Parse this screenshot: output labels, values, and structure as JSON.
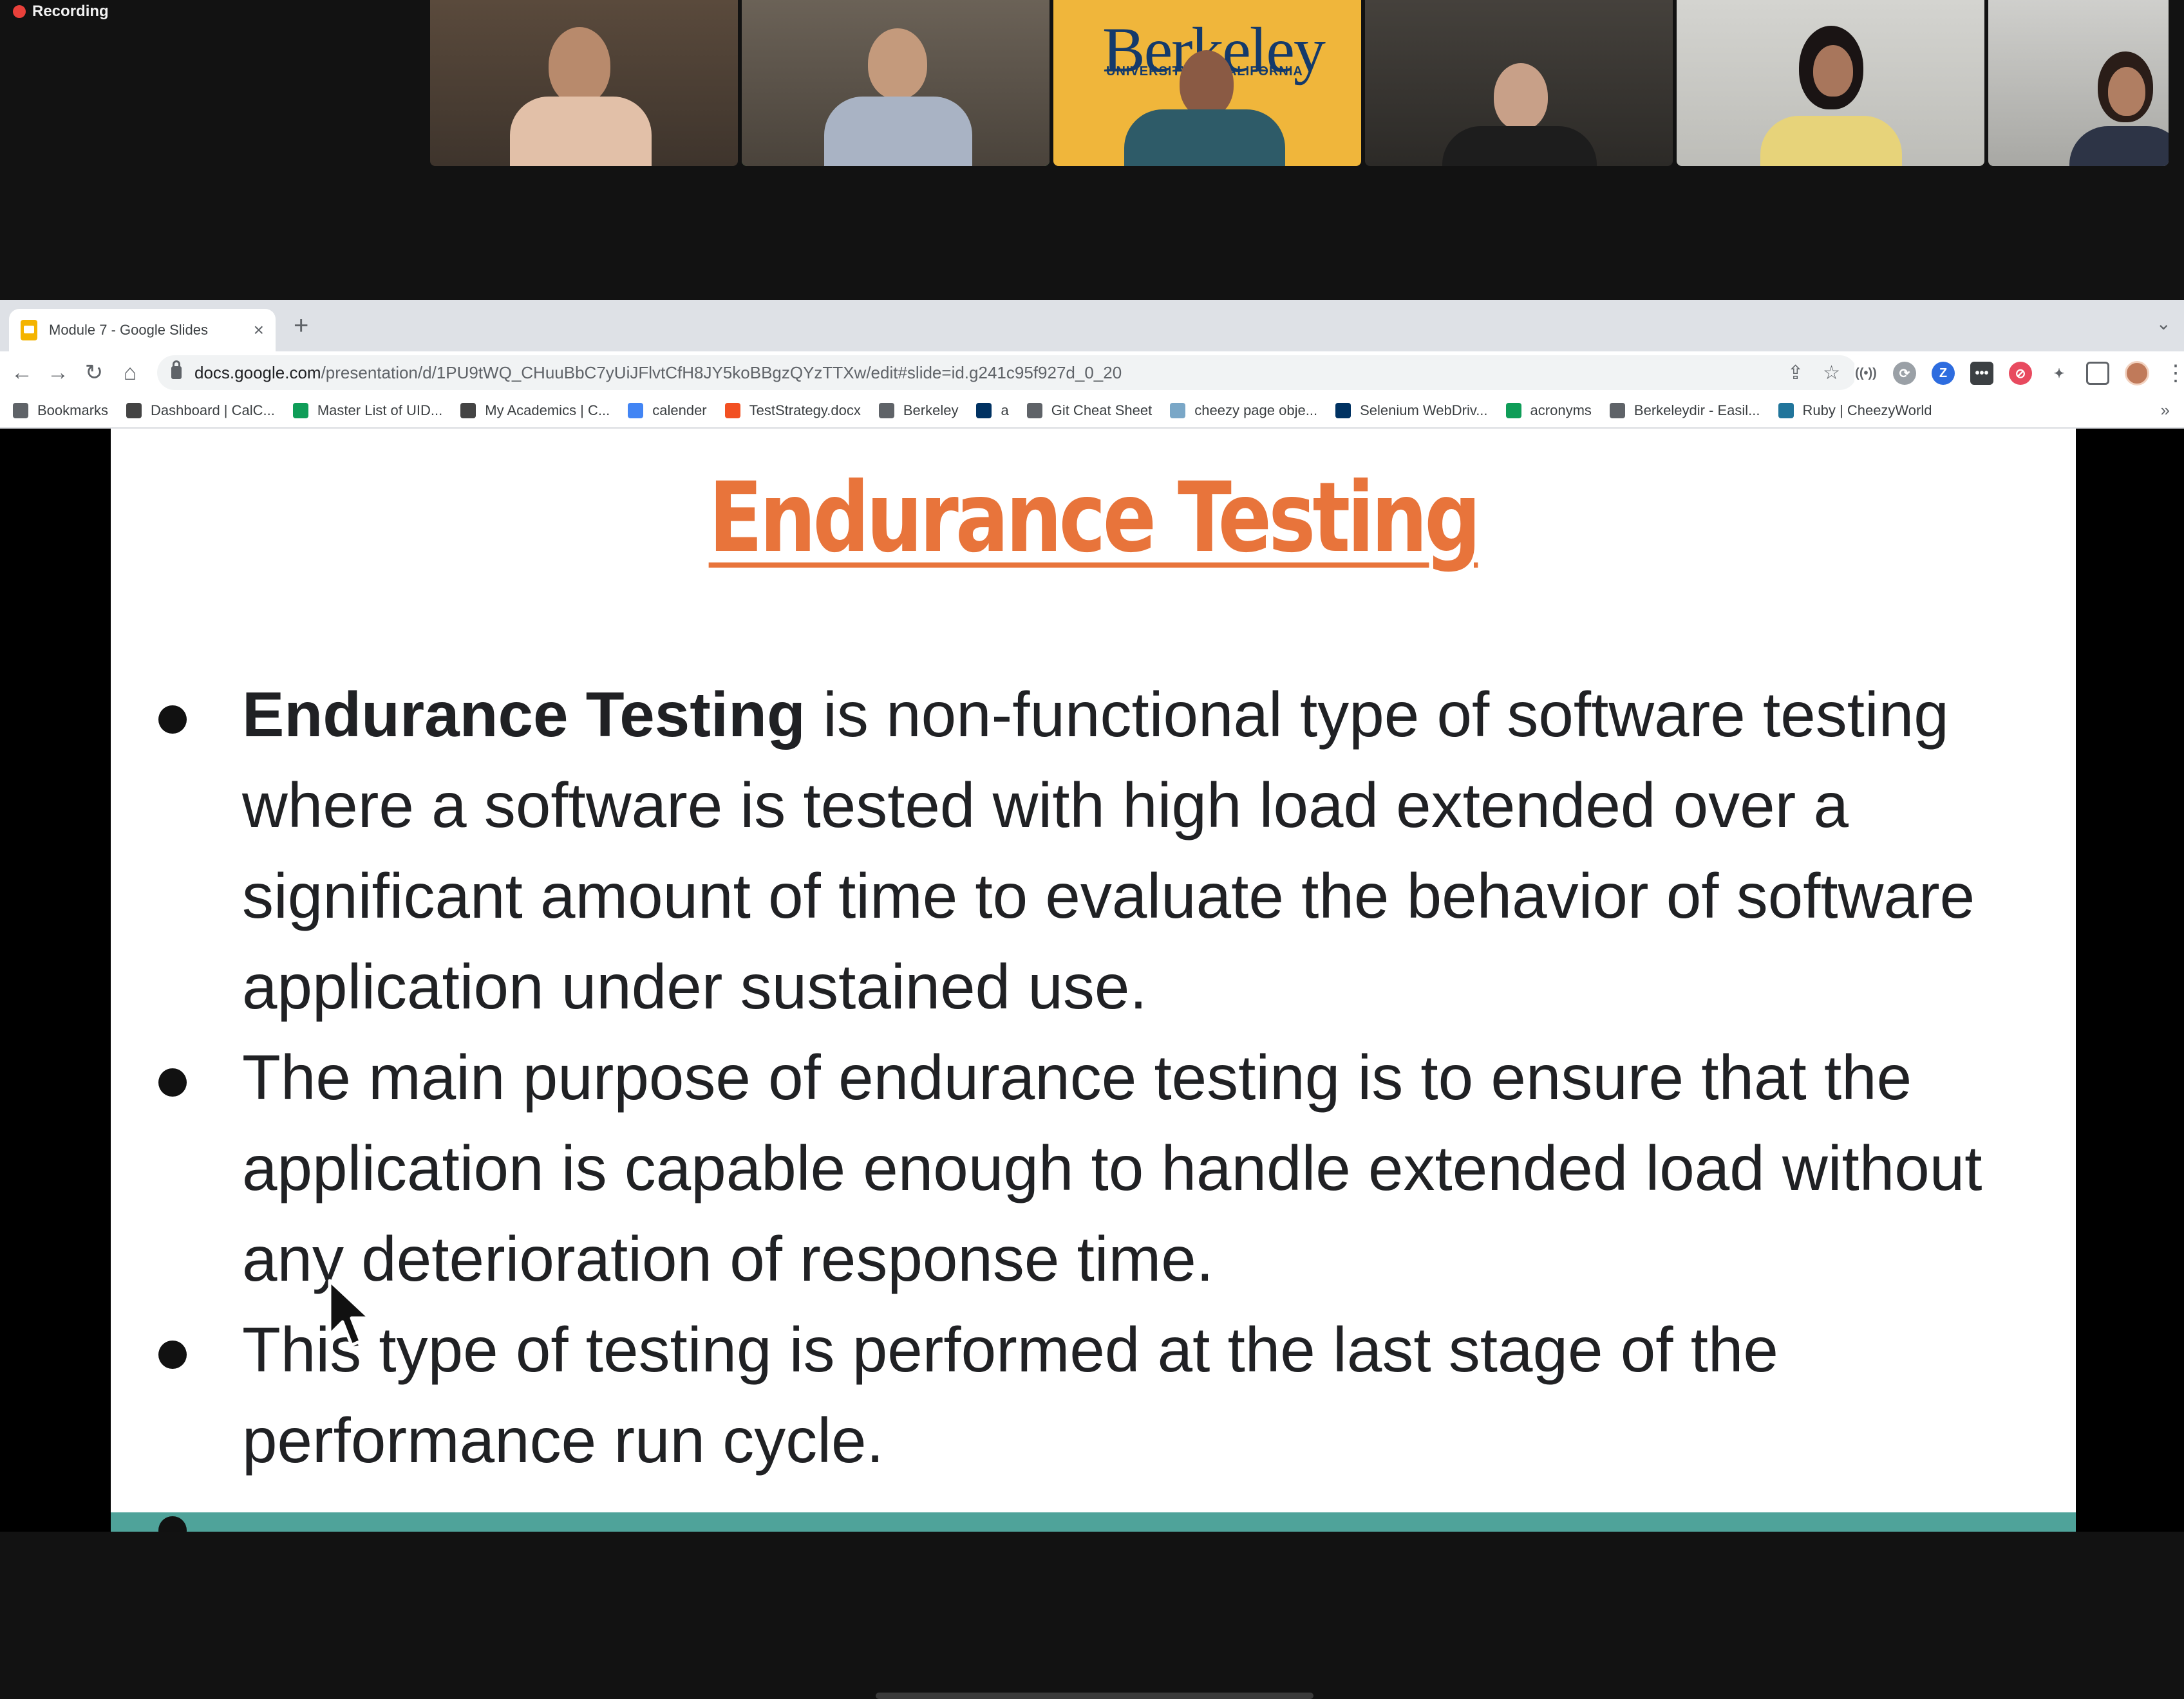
{
  "meeting": {
    "recording_label": "Recording",
    "berkeley_logo_text": "Berkeley",
    "berkeley_logo_sub": "UNIVERSITY OF CALIFORNIA"
  },
  "browser": {
    "tab": {
      "title": "Module 7 - Google Slides",
      "close_glyph": "×"
    },
    "new_tab_glyph": "+",
    "tab_menu_glyph": "⌄",
    "nav": {
      "back": "←",
      "forward": "→",
      "reload": "↻",
      "home": "⌂"
    },
    "url_host": "docs.google.com",
    "url_path": "/presentation/d/1PU9tWQ_CHuuBbC7yUiJFlvtCfH8JY5koBBgzQYzTTXw/edit#slide=id.g241c95f927d_0_20",
    "bookmarks": [
      {
        "label": "Bookmarks",
        "icon": "star-icon",
        "color": "#5f6368"
      },
      {
        "label": "Dashboard | CalC...",
        "icon": "c-logo-icon",
        "color": "#444444"
      },
      {
        "label": "Master List of UID...",
        "icon": "sheets-icon",
        "color": "#0f9d58"
      },
      {
        "label": "My Academics | C...",
        "icon": "c-logo-icon",
        "color": "#444444"
      },
      {
        "label": "calender",
        "icon": "calendar-icon",
        "color": "#4285f4"
      },
      {
        "label": "TestStrategy.docx",
        "icon": "windows-icon",
        "color": "#f25022"
      },
      {
        "label": "Berkeley",
        "icon": "folder-icon",
        "color": "#5f6368"
      },
      {
        "label": "a",
        "icon": "cal-icon",
        "color": "#003262"
      },
      {
        "label": "Git Cheat Sheet",
        "icon": "bookmark-icon",
        "color": "#5f6368"
      },
      {
        "label": "cheezy page obje...",
        "icon": "cheezy-icon",
        "color": "#7aa7c7"
      },
      {
        "label": "Selenium WebDriv...",
        "icon": "cal-icon",
        "color": "#003262"
      },
      {
        "label": "acronyms",
        "icon": "sheets-icon",
        "color": "#0f9d58"
      },
      {
        "label": "Berkeleydir - Easil...",
        "icon": "globe-icon",
        "color": "#5f6368"
      },
      {
        "label": "Ruby | CheezyWorld",
        "icon": "wordpress-icon",
        "color": "#21759b"
      }
    ],
    "more_glyph": "»"
  },
  "slide": {
    "title": "Endurance Testing",
    "bullets": [
      {
        "bold": "Endurance Testing",
        "text": " is non-functional type of software testing where a software is tested with high load extended over a significant amount of time to evaluate the behavior of software application under sustained use."
      },
      {
        "bold": "",
        "text": "The main purpose of endurance testing is to ensure that the application is capable enough to handle extended load without any deterioration of response time."
      },
      {
        "bold": "",
        "text": "This type of testing is performed at the last stage of the performance run cycle."
      }
    ],
    "colors": {
      "title": "#e8743b",
      "footer_bar": "#4fa39a"
    }
  }
}
